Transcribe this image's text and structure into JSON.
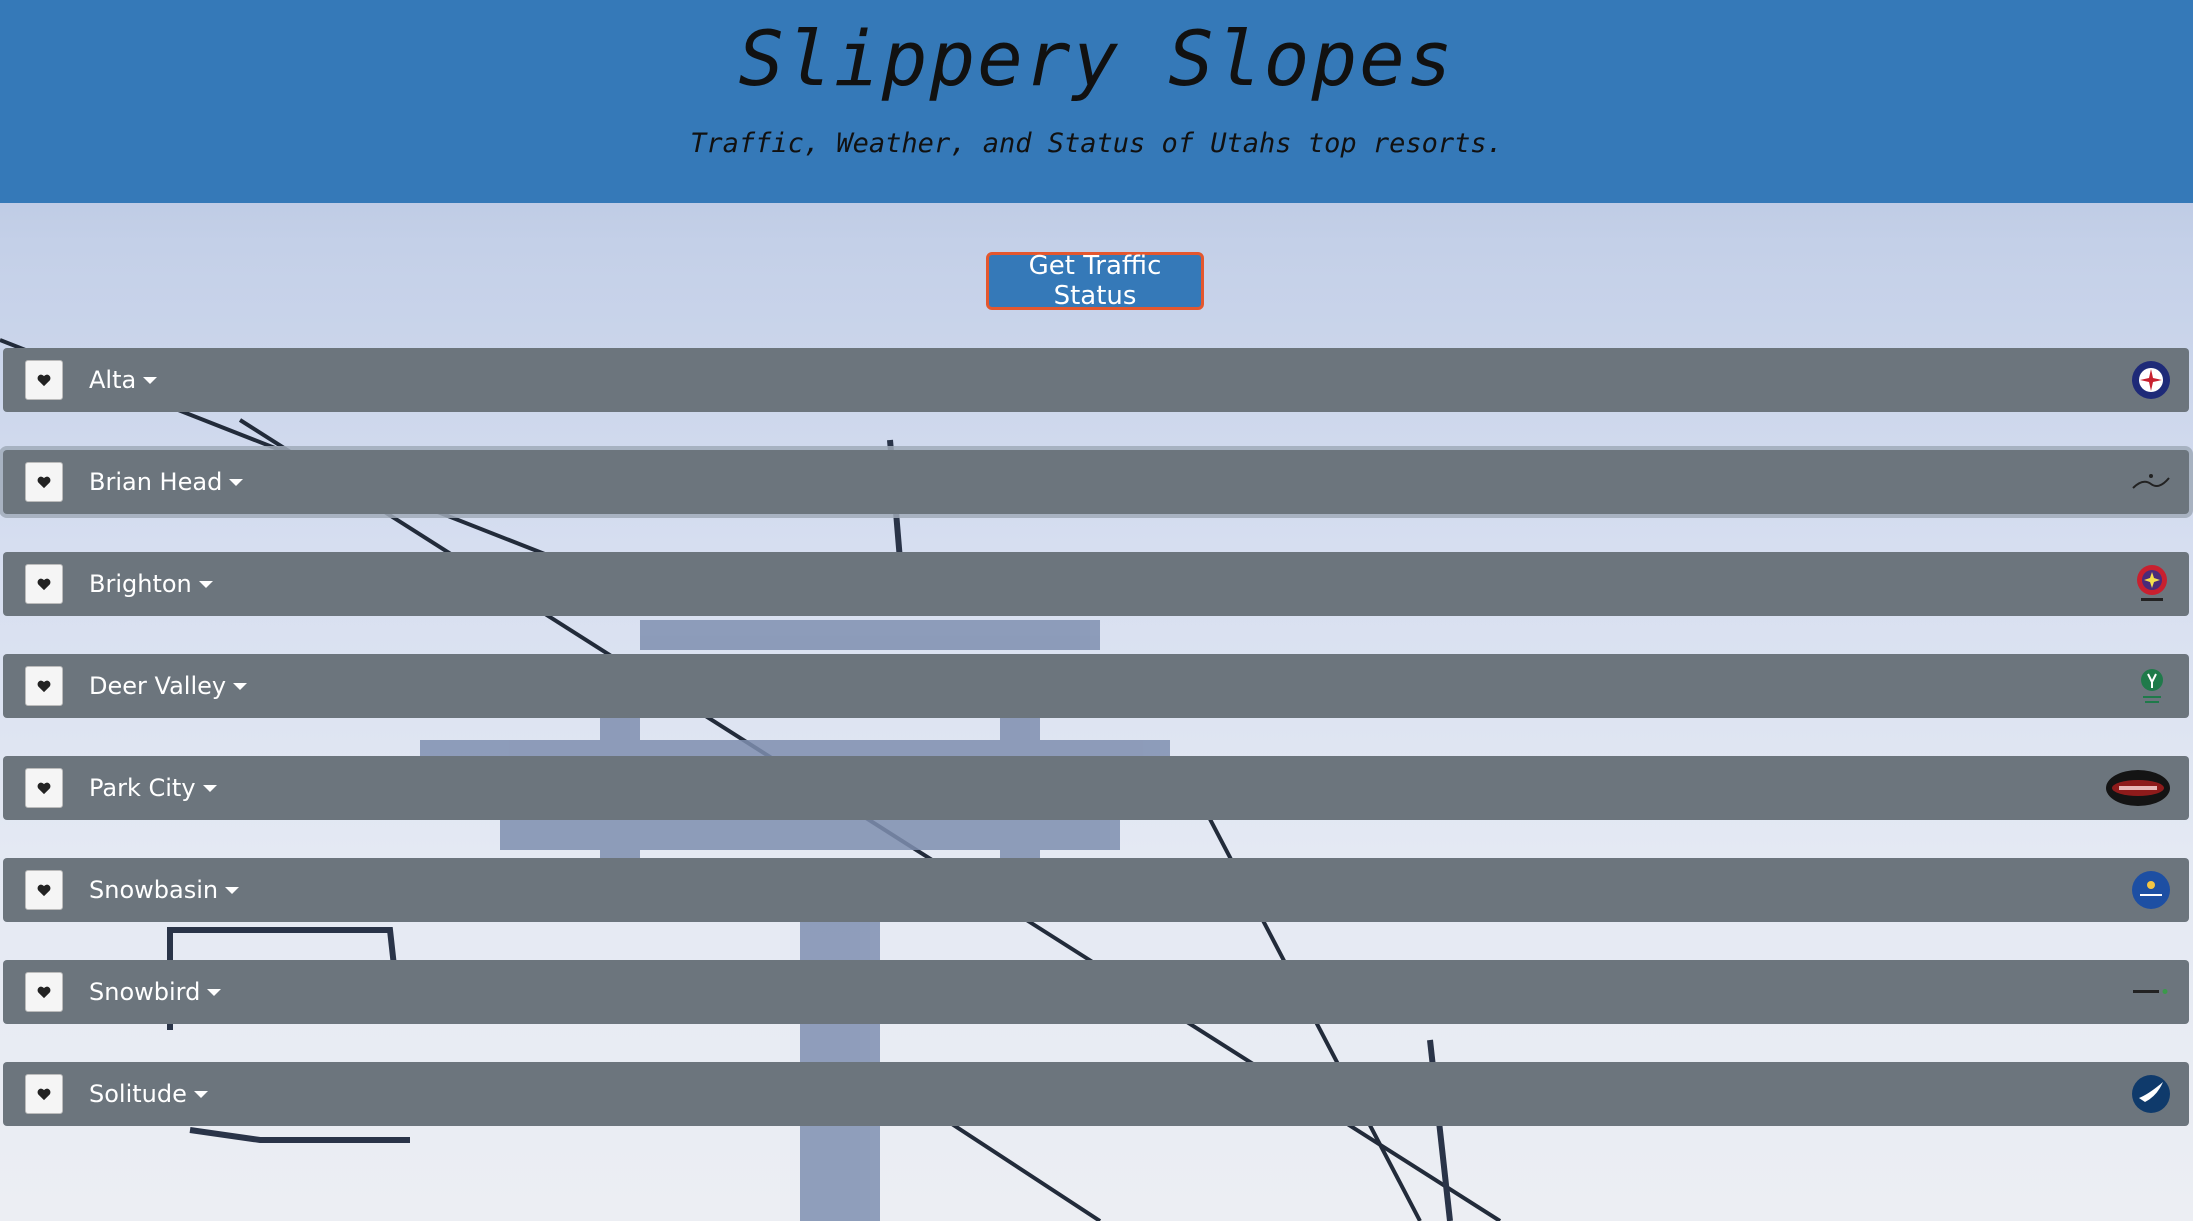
{
  "header": {
    "title": "Slippery Slopes",
    "subtitle": "Traffic, Weather, and Status of Utahs top resorts."
  },
  "traffic_button": {
    "label": "Get Traffic Status"
  },
  "resorts": [
    {
      "name": "Alta",
      "logo_icon": "alta-logo-icon"
    },
    {
      "name": "Brian Head",
      "logo_icon": "brian-head-logo-icon"
    },
    {
      "name": "Brighton",
      "logo_icon": "brighton-logo-icon"
    },
    {
      "name": "Deer Valley",
      "logo_icon": "deer-valley-logo-icon"
    },
    {
      "name": "Park City",
      "logo_icon": "park-city-logo-icon"
    },
    {
      "name": "Snowbasin",
      "logo_icon": "snowbasin-logo-icon"
    },
    {
      "name": "Snowbird",
      "logo_icon": "snowbird-logo-icon"
    },
    {
      "name": "Solitude",
      "logo_icon": "solitude-logo-icon"
    }
  ],
  "colors": {
    "header_bg": "#3579b8",
    "row_bg": "#6c757d",
    "button_border": "#e4572e"
  }
}
